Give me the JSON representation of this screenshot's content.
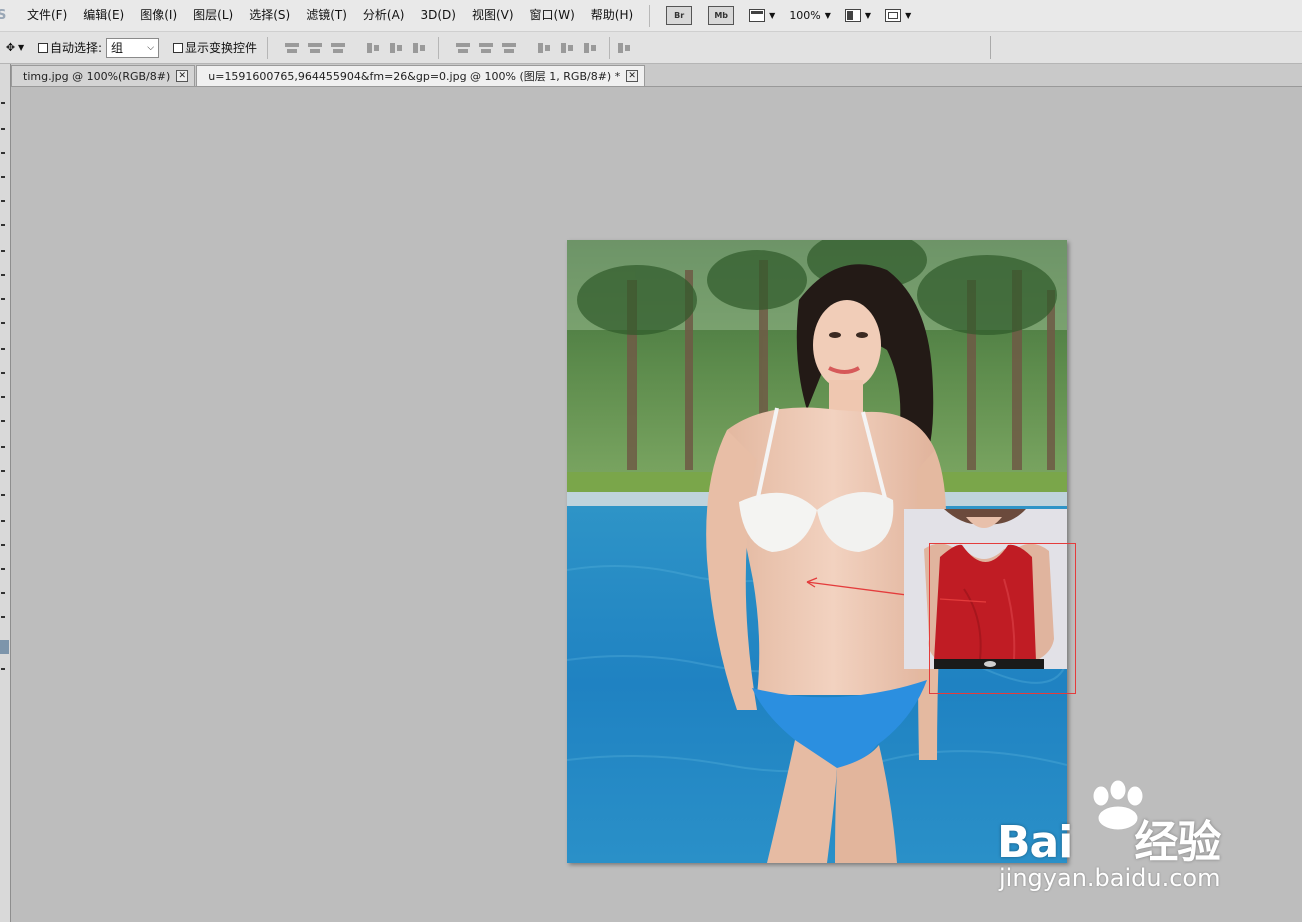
{
  "menubar": {
    "items": [
      {
        "label": "文件(F)"
      },
      {
        "label": "编辑(E)"
      },
      {
        "label": "图像(I)"
      },
      {
        "label": "图层(L)"
      },
      {
        "label": "选择(S)"
      },
      {
        "label": "滤镜(T)"
      },
      {
        "label": "分析(A)"
      },
      {
        "label": "3D(D)"
      },
      {
        "label": "视图(V)"
      },
      {
        "label": "窗口(W)"
      },
      {
        "label": "帮助(H)"
      }
    ],
    "bridge_label": "Br",
    "minibridge_label": "Mb",
    "zoom_value": "100%"
  },
  "options": {
    "auto_select_label": "自动选择:",
    "auto_select_value": "组",
    "show_transform_label": "显示变换控件"
  },
  "tabs": [
    {
      "title": "timg.jpg @ 100%(RGB/8#)",
      "active": false
    },
    {
      "title": "u=1591600765,964455904&fm=26&gp=0.jpg @ 100% (图层 1, RGB/8#) *",
      "active": true
    }
  ],
  "watermark": {
    "brand": "Bai",
    "brand_suffix": "经验",
    "url": "jingyan.baidu.com"
  },
  "colors": {
    "selection": "#e43c3c",
    "canvas_bg": "#bdbdbd"
  }
}
